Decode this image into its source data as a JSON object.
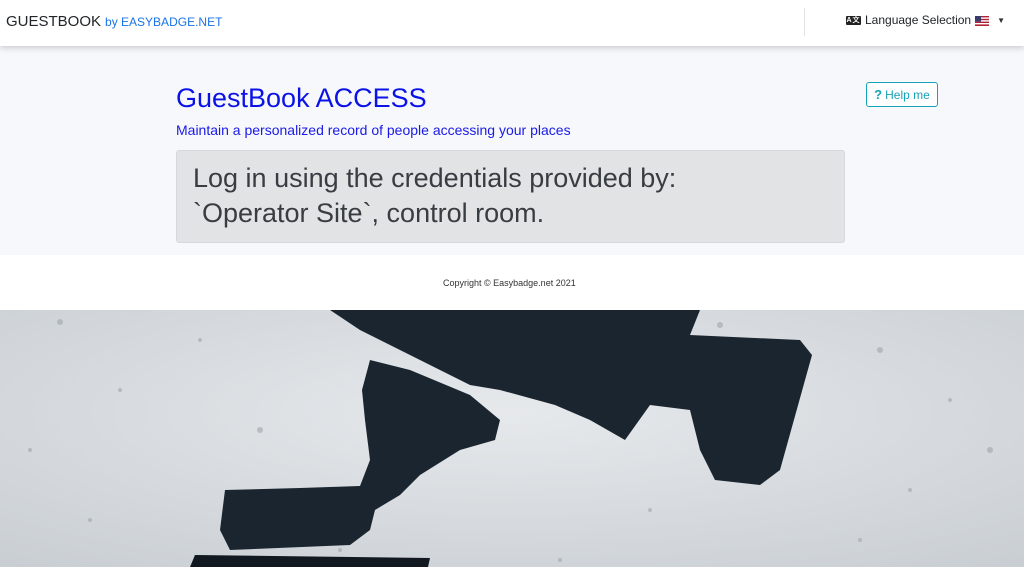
{
  "navbar": {
    "brand": "GUESTBOOK",
    "brand_by": "by EASYBADGE.NET",
    "language_icon": "language-icon",
    "language_label": "Language Selection",
    "flag": "us-flag-icon"
  },
  "hero": {
    "title": "GuestBook ACCESS",
    "subtitle": "Maintain a personalized record of people accessing your places",
    "help_label": "Help me",
    "help_icon": "?",
    "notice_line1": "Log in using the credentials provided by:",
    "notice_line2": "`Operator Site`, control room."
  },
  "footer": {
    "copyright": "Copyright © Easybadge.net 2021"
  },
  "colors": {
    "title": "#0b12e8",
    "help": "#17a2b8",
    "notice_bg": "#e2e3e5",
    "brand_link": "#1a73e8"
  }
}
